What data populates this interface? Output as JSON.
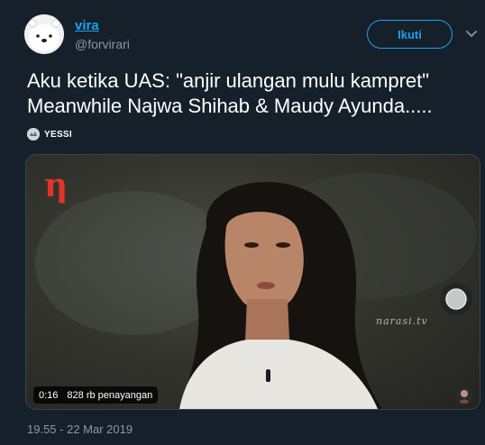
{
  "user": {
    "display_name": "vira",
    "handle": "@forvirari"
  },
  "follow_button": {
    "label": "Ikuti"
  },
  "tweet": {
    "lines": [
      "Aku ketika UAS: \"anjir ulangan mulu kampret\"",
      "Meanwhile Najwa Shihab & Maudy Ayunda....."
    ],
    "emoji_label": "YESSI"
  },
  "video": {
    "brand_glyph": "η",
    "watermark": "narasi.tv",
    "duration": "0:16",
    "views": "828 rb penayangan"
  },
  "timestamp": "19.55 - 22 Mar 2019",
  "colors": {
    "background": "#15202b",
    "accent": "#1da1f2",
    "secondary_text": "#8899a6"
  },
  "icons": {
    "caret": "chevron-down-icon",
    "play": "play-icon"
  }
}
